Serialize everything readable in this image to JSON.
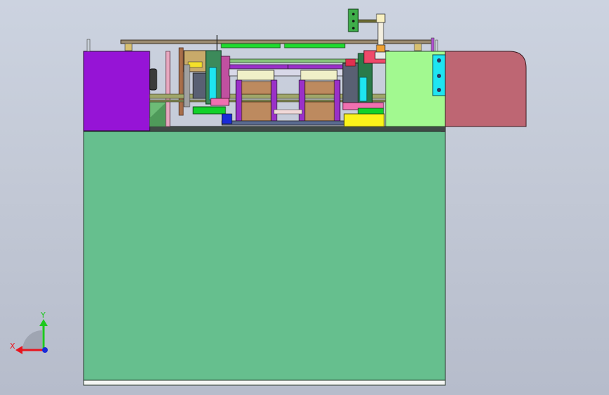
{
  "viewport": {
    "background_top": "#ccd3e0",
    "background_bottom": "#b6bccb"
  },
  "model": {
    "palette": {
      "frame_green": "#66bf8e",
      "motor_purple": "#9614d6",
      "box_lightgreen": "#a2f990",
      "cover_red": "#be6673",
      "bearing_yellow": "#fbf31a",
      "wood_tan": "#bd8a5f",
      "cyan_part": "#1ee5f2",
      "bright_green": "#11d12a",
      "rail_olive": "#9fa66a"
    }
  },
  "triad": {
    "x_label": "X",
    "y_label": "Y",
    "x_color": "#e8141e",
    "y_color": "#1ec81e",
    "origin_color": "#1a2ad8"
  }
}
